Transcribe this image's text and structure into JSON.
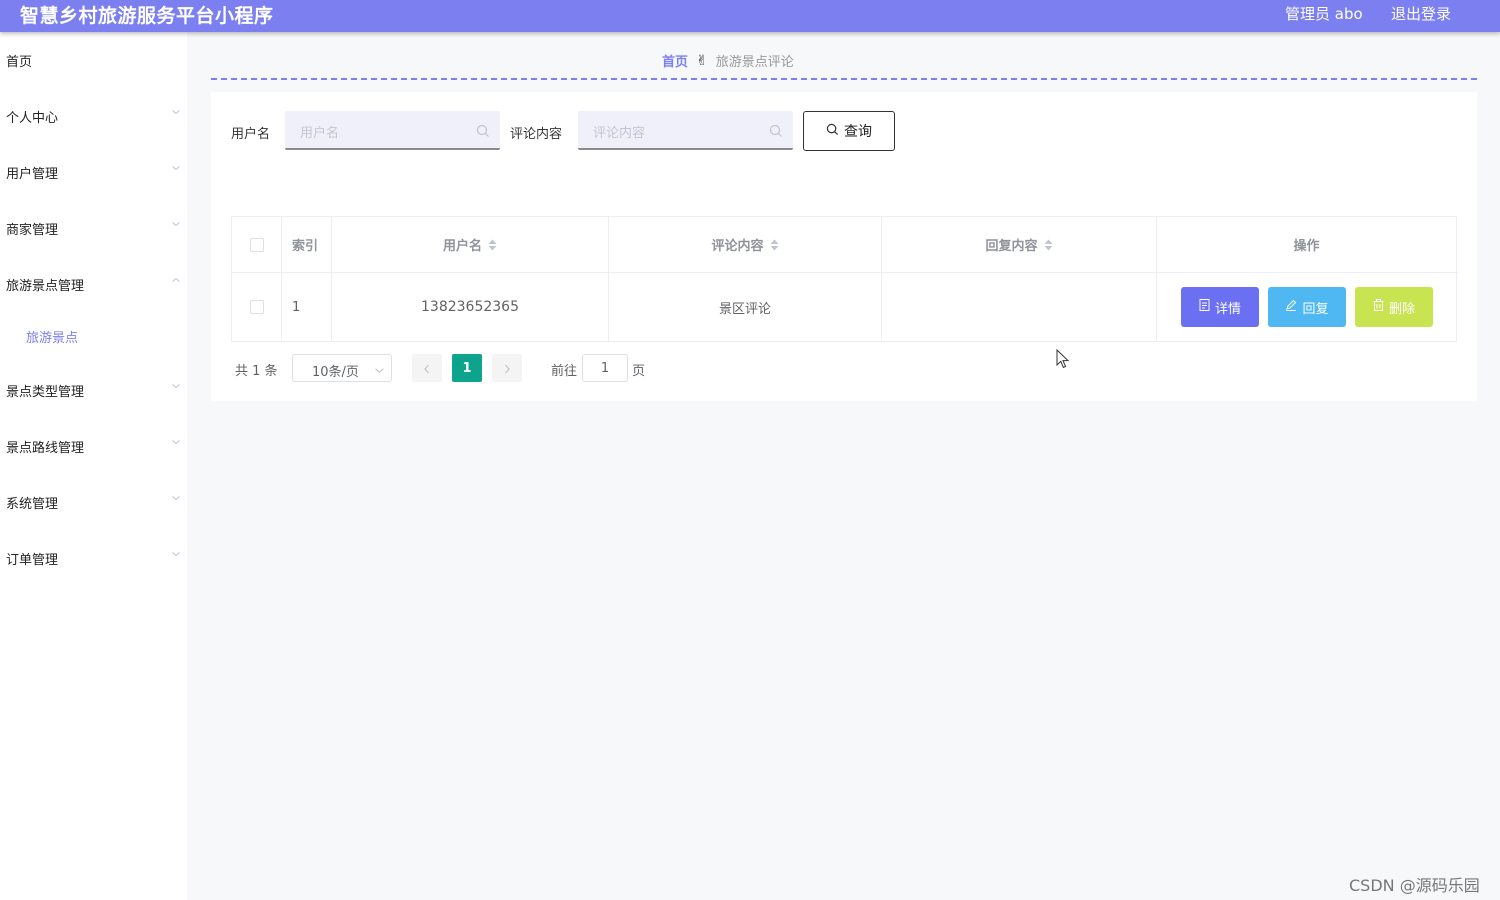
{
  "header": {
    "app_title": "智慧乡村旅游服务平台小程序",
    "user_info": "管理员 abo",
    "logout_label": "退出登录"
  },
  "sidebar": {
    "items": [
      {
        "label": "首页"
      },
      {
        "label": "个人中心"
      },
      {
        "label": "用户管理"
      },
      {
        "label": "商家管理"
      },
      {
        "label": "旅游景点管理"
      },
      {
        "label": "景点类型管理"
      },
      {
        "label": "景点路线管理"
      },
      {
        "label": "系统管理"
      },
      {
        "label": "订单管理"
      }
    ],
    "active_sub": "旅游景点"
  },
  "breadcrumb": {
    "home": "首页",
    "current": "旅游景点评论"
  },
  "search": {
    "username_label": "用户名",
    "username_placeholder": "用户名",
    "comment_label": "评论内容",
    "comment_placeholder": "评论内容",
    "query_label": "查询"
  },
  "table": {
    "headers": [
      "索引",
      "用户名",
      "评论内容",
      "回复内容",
      "操作"
    ],
    "rows": [
      {
        "index": "1",
        "username": "13823652365",
        "comment": "景区评论",
        "reply": ""
      }
    ],
    "actions": {
      "detail": "详情",
      "reply": "回复",
      "delete": "删除"
    }
  },
  "pagination": {
    "total": "共 1 条",
    "page_size": "10条/页",
    "current_page": "1",
    "goto_label": "前往",
    "goto_value": "1",
    "goto_suffix": "页"
  },
  "watermark": "CSDN @源码乐园",
  "colors": {
    "primary": "#7b7ff0",
    "detail_button": "#6b6ff2",
    "reply_button": "#4fb8f3",
    "delete_button": "#c8e451",
    "current_page": "#0ea38c"
  }
}
